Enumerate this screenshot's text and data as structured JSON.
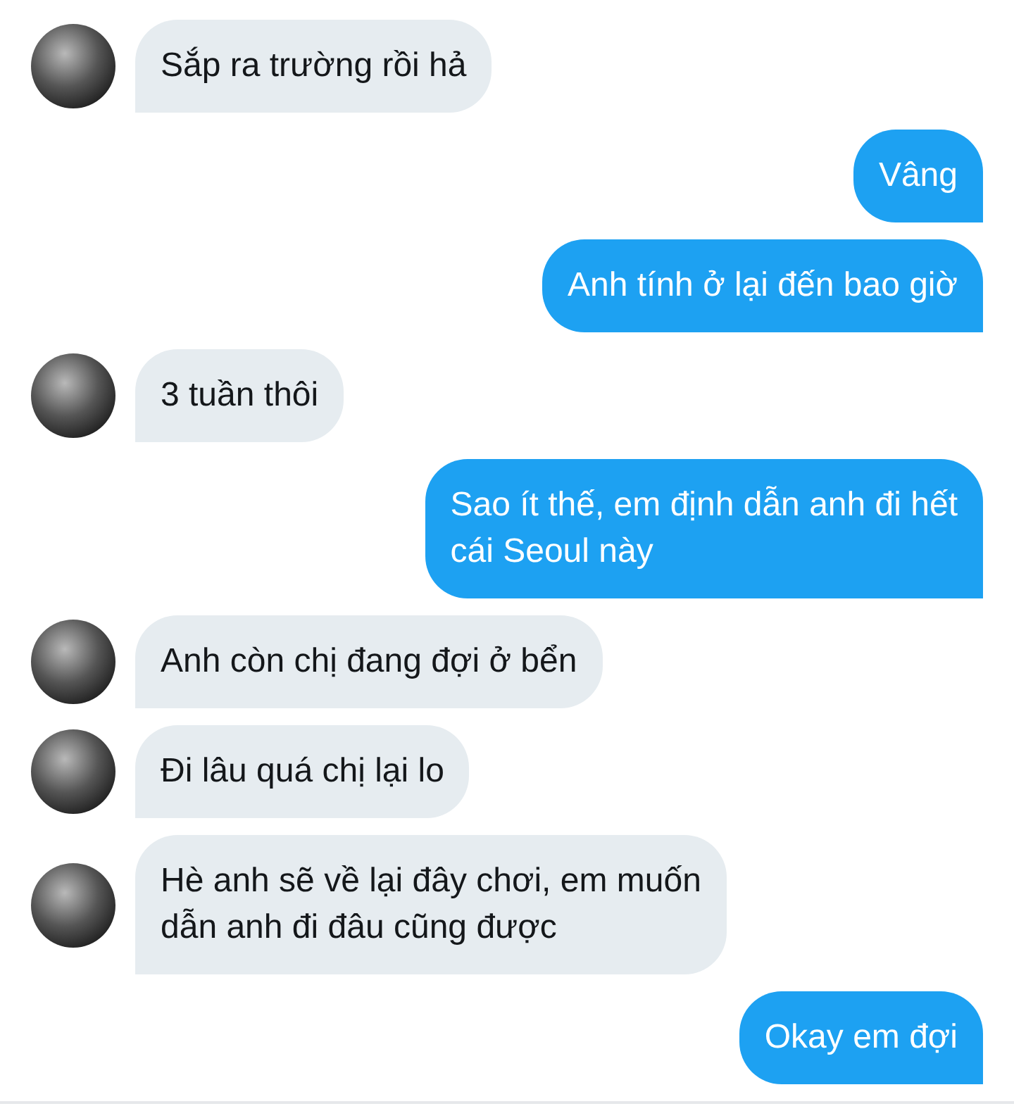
{
  "messages": [
    {
      "kind": "received",
      "lines": [
        "Sắp ra trường rồi hả"
      ]
    },
    {
      "kind": "sent",
      "lines": [
        "Vâng"
      ]
    },
    {
      "kind": "sent",
      "lines": [
        "Anh tính ở lại đến bao giờ"
      ]
    },
    {
      "kind": "received",
      "lines": [
        "3 tuần thôi"
      ]
    },
    {
      "kind": "sent",
      "lines": [
        "Sao ít thế, em định dẫn anh đi hết",
        "cái Seoul này"
      ]
    },
    {
      "kind": "received",
      "lines": [
        "Anh còn chị đang đợi ở bển"
      ]
    },
    {
      "kind": "received",
      "lines": [
        "Đi lâu quá chị lại lo"
      ]
    },
    {
      "kind": "received",
      "lines": [
        "Hè anh sẽ về lại đây chơi, em muốn",
        "dẫn anh đi đâu cũng được"
      ]
    },
    {
      "kind": "sent",
      "lines": [
        "Okay em đợi"
      ]
    }
  ]
}
